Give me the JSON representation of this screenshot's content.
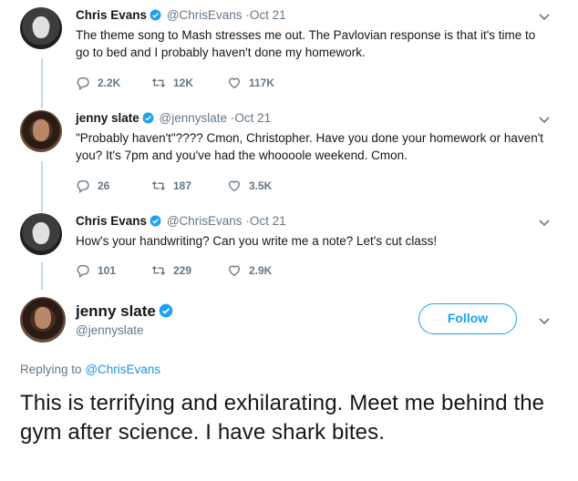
{
  "colors": {
    "accent": "#1da1f2",
    "mention": "#1b95e0",
    "secondary_text": "#657786",
    "thread_line": "#b8dcf5"
  },
  "tweets": [
    {
      "name": "Chris Evans",
      "handle": "@ChrisEvans",
      "dot": "·",
      "date": "Oct 21",
      "text": "The theme song to Mash stresses me out. The Pavlovian response is that it's time to go to bed and I probably haven't done my homework.",
      "replies": "2.2K",
      "retweets": "12K",
      "likes": "117K",
      "avatar_icon": "chris-evans-avatar"
    },
    {
      "name": "jenny slate",
      "handle": "@jennyslate",
      "dot": "·",
      "date": "Oct 21",
      "text": "\"Probably haven't\"???? Cmon, Christopher. Have you done your homework or haven't you? It's 7pm and you've had the whoooole weekend. Cmon.",
      "replies": "26",
      "retweets": "187",
      "likes": "3.5K",
      "avatar_icon": "jenny-slate-avatar"
    },
    {
      "name": "Chris Evans",
      "handle": "@ChrisEvans",
      "dot": "·",
      "date": "Oct 21",
      "text": "How's your handwriting? Can you write me a note? Let's cut class!",
      "replies": "101",
      "retweets": "229",
      "likes": "2.9K",
      "avatar_icon": "chris-evans-avatar"
    }
  ],
  "main_tweet": {
    "name": "jenny slate",
    "handle": "@jennyslate",
    "follow_label": "Follow",
    "replying_prefix": "Replying to",
    "replying_to": "@ChrisEvans",
    "text": "This is terrifying and exhilarating. Meet me behind the gym after science. I have shark bites."
  },
  "icons": [
    "verified-badge-icon",
    "reply-icon",
    "retweet-icon",
    "like-icon",
    "chevron-down-icon"
  ]
}
